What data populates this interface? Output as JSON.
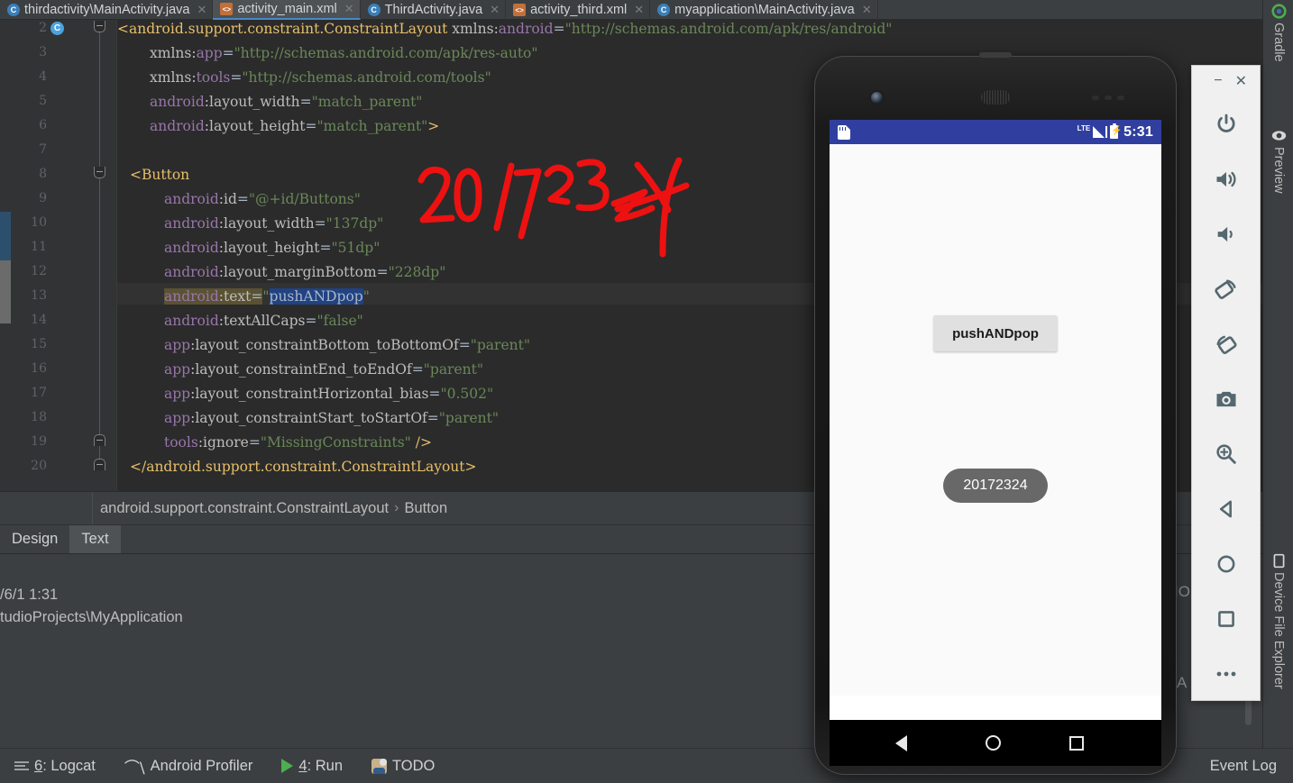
{
  "tabs": [
    {
      "label": "thirdactivity\\MainActivity.java",
      "icon": "java-file-icon",
      "active": false
    },
    {
      "label": "activity_main.xml",
      "icon": "xml-file-icon",
      "active": true
    },
    {
      "label": "ThirdActivity.java",
      "icon": "java-file-icon",
      "active": false
    },
    {
      "label": "activity_third.xml",
      "icon": "xml-file-icon",
      "active": false
    },
    {
      "label": "myapplication\\MainActivity.java",
      "icon": "java-file-icon",
      "active": false
    }
  ],
  "editor": {
    "line_numbers": [
      "2",
      "3",
      "4",
      "5",
      "6",
      "7",
      "8",
      "9",
      "10",
      "11",
      "12",
      "13",
      "14",
      "15",
      "16",
      "17",
      "18",
      "19",
      "20"
    ],
    "lines": [
      "<android.support.constraint.ConstraintLayout xmlns:android=\"http://schemas.android.com/apk/res/android\"",
      "xmlns:app=\"http://schemas.android.com/apk/res-auto\"",
      "xmlns:tools=\"http://schemas.android.com/tools\"",
      "android:layout_width=\"match_parent\"",
      "android:layout_height=\"match_parent\">",
      "",
      "<Button",
      "android:id=\"@+id/Buttons\"",
      "android:layout_width=\"137dp\"",
      "android:layout_height=\"51dp\"",
      "android:layout_marginBottom=\"228dp\"",
      "android:text=\"pushANDpop\"",
      "android:textAllCaps=\"false\"",
      "app:layout_constraintBottom_toBottomOf=\"parent\"",
      "app:layout_constraintEnd_toEndOf=\"parent\"",
      "app:layout_constraintHorizontal_bias=\"0.502\"",
      "app:layout_constraintStart_toStartOf=\"parent\"",
      "tools:ignore=\"MissingConstraints\" />",
      "</android.support.constraint.ConstraintLayout>"
    ],
    "annotation": "20172324"
  },
  "breadcrumb": {
    "parent": "android.support.constraint.ConstraintLayout",
    "separator": "›",
    "child": "Button"
  },
  "design_text_tabs": [
    {
      "label": "Design",
      "active": false
    },
    {
      "label": "Text",
      "active": true
    }
  ],
  "run_panel": {
    "line1": "/6/1 1:31",
    "line2": "tudioProjects\\MyApplication"
  },
  "status_toolbar": {
    "items": [
      {
        "label_num": "6",
        "label": ": Logcat",
        "icon": "logcat-icon"
      },
      {
        "label_num": "",
        "label": "Android Profiler",
        "icon": "profiler-icon"
      },
      {
        "label_num": "4",
        "label": ": Run",
        "icon": "run-icon"
      },
      {
        "label_num": "",
        "label": "TODO",
        "icon": "todo-icon"
      }
    ],
    "event_log": "Event Log"
  },
  "right_sidebar": [
    {
      "label": "Gradle",
      "icon": "gradle-icon"
    },
    {
      "label": "Preview",
      "icon": "eye-icon"
    },
    {
      "label": "Device File Explorer",
      "icon": "device-file-icon"
    }
  ],
  "emulator": {
    "status_bar": {
      "time": "5:31",
      "network": "LTE",
      "sd_icon": "sd-card-icon",
      "battery_icon": "battery-charging-icon"
    },
    "app": {
      "button_label": "pushANDpop",
      "toast_label": "20172324"
    },
    "nav": [
      "back",
      "home",
      "recents"
    ],
    "toolbar": {
      "minimize": "−",
      "close": "✕",
      "buttons": [
        "power-icon",
        "volume-up-icon",
        "volume-down-icon",
        "rotate-left-icon",
        "rotate-right-icon",
        "camera-icon",
        "zoom-icon",
        "back-icon",
        "home-icon",
        "overview-icon",
        "more-icon"
      ]
    }
  },
  "peek_text": {
    "a": "IO",
    "b": "A"
  },
  "colors": {
    "editor_bg": "#2b2b2b",
    "panel_bg": "#3c3f41",
    "accent_blue": "#4a88c7",
    "android_blue": "#303f9f",
    "annotation_red": "#ee1111",
    "string_green": "#6a8759",
    "tag_gold": "#e8bf6a"
  }
}
